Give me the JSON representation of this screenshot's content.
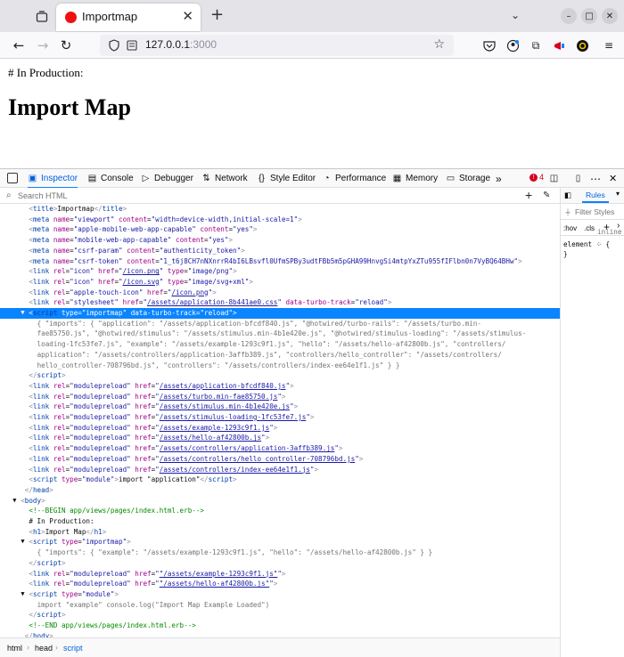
{
  "browser": {
    "tab_title": "Importmap",
    "url_host": "127.0.0.1",
    "url_port": ":3000"
  },
  "page": {
    "production_text": "# In Production:",
    "heading": "Import Map"
  },
  "devtools": {
    "tabs": [
      "Inspector",
      "Console",
      "Debugger",
      "Network",
      "Style Editor",
      "Performance",
      "Memory",
      "Storage"
    ],
    "error_count": "4",
    "search_placeholder": "Search HTML",
    "side_tab": "Rules",
    "filter_placeholder": "Filter Styles",
    "hov": ":hov",
    "cls": ".cls",
    "rule_inline": "inline",
    "rule_element": "element",
    "rule_open": "{",
    "rule_close": "}",
    "breadcrumb": [
      "html",
      "head",
      "script"
    ]
  },
  "colors": {
    "accent": "#0a84ff",
    "favicon": "#ee1111",
    "comment": "#058b00"
  },
  "markup_lines": [
    {
      "indent": 4,
      "html": "<span class='tag'>&lt;</span><span class='tn'>title</span><span class='tag'>&gt;</span>Importmap<span class='tag'>&lt;/</span><span class='tn'>title</span><span class='tag'>&gt;</span>"
    },
    {
      "indent": 4,
      "html": "<span class='tag'>&lt;</span><span class='tn'>meta</span> <span class='an'>name</span>=<span class='av'>\"viewport\"</span> <span class='an'>content</span>=<span class='av'>\"width=device-width,initial-scale=1\"</span><span class='tag'>&gt;</span>"
    },
    {
      "indent": 4,
      "html": "<span class='tag'>&lt;</span><span class='tn'>meta</span> <span class='an'>name</span>=<span class='av'>\"apple-mobile-web-app-capable\"</span> <span class='an'>content</span>=<span class='av'>\"yes\"</span><span class='tag'>&gt;</span>"
    },
    {
      "indent": 4,
      "html": "<span class='tag'>&lt;</span><span class='tn'>meta</span> <span class='an'>name</span>=<span class='av'>\"mobile-web-app-capable\"</span> <span class='an'>content</span>=<span class='av'>\"yes\"</span><span class='tag'>&gt;</span>"
    },
    {
      "indent": 4,
      "html": "<span class='tag'>&lt;</span><span class='tn'>meta</span> <span class='an'>name</span>=<span class='av'>\"csrf-param\"</span> <span class='an'>content</span>=<span class='av'>\"authenticity_token\"</span><span class='tag'>&gt;</span>"
    },
    {
      "indent": 4,
      "html": "<span class='tag'>&lt;</span><span class='tn'>meta</span> <span class='an'>name</span>=<span class='av'>\"csrf-token\"</span> <span class='an'>content</span>=<span class='av'>\"1_t6j8CH7nNXnrrR4bI6LBsvfl0UfmSPBy3udtFBb5m5pGHA99HnvgSi4mtpYxZTu955fIFlbn0n7VyBQ64BHw\"</span><span class='tag'>&gt;</span>"
    },
    {
      "indent": 4,
      "html": "<span class='tag'>&lt;</span><span class='tn'>link</span> <span class='an'>rel</span>=<span class='av'>\"icon\"</span> <span class='an'>href</span>=<span class='av'>\"<span class='lk'>/icon.png</span>\"</span> <span class='an'>type</span>=<span class='av'>\"image/png\"</span><span class='tag'>&gt;</span>"
    },
    {
      "indent": 4,
      "html": "<span class='tag'>&lt;</span><span class='tn'>link</span> <span class='an'>rel</span>=<span class='av'>\"icon\"</span> <span class='an'>href</span>=<span class='av'>\"<span class='lk'>/icon.svg</span>\"</span> <span class='an'>type</span>=<span class='av'>\"image/svg+xml\"</span><span class='tag'>&gt;</span>"
    },
    {
      "indent": 4,
      "html": "<span class='tag'>&lt;</span><span class='tn'>link</span> <span class='an'>rel</span>=<span class='av'>\"apple-touch-icon\"</span> <span class='an'>href</span>=<span class='av'>\"<span class='lk'>/icon.png</span>\"</span><span class='tag'>&gt;</span>"
    },
    {
      "indent": 4,
      "html": "<span class='tag'>&lt;</span><span class='tn'>link</span> <span class='an'>rel</span>=<span class='av'>\"stylesheet\"</span> <span class='an'>href</span>=<span class='av'>\"<span class='lk'>/assets/application-8b441ae0.css</span>\"</span> <span class='an'>data-turbo-track</span>=<span class='av'>\"reload\"</span><span class='tag'>&gt;</span>"
    },
    {
      "indent": 4,
      "sel": true,
      "twisty": "▼",
      "html": "<span class='tag'>&lt;</span><span class='tn'>script</span> <span class='an'>type</span>=<span class='av'>\"importmap\"</span> <span class='an'>data-turbo-track</span>=<span class='av'>\"reload\"</span><span class='tag'>&gt;</span>"
    },
    {
      "indent": 6,
      "html": "<span class='gr'>{ \"imports\": { \"application\": \"/assets/application-bfcdf840.js\", \"@hotwired/turbo-rails\": \"/assets/turbo.min-</span>"
    },
    {
      "indent": 6,
      "html": "<span class='gr'>fae85750.js\", \"@hotwired/stimulus\": \"/assets/stimulus.min-4b1e420e.js\", \"@hotwired/stimulus-loading\": \"/assets/stimulus-</span>"
    },
    {
      "indent": 6,
      "html": "<span class='gr'>loading-1fc53fe7.js\", \"example\": \"/assets/example-1293c9f1.js\", \"hello\": \"/assets/hello-af42800b.js\", \"controllers/</span>"
    },
    {
      "indent": 6,
      "html": "<span class='gr'>application\": \"/assets/controllers/application-3affb389.js\", \"controllers/hello_controller\": \"/assets/controllers/</span>"
    },
    {
      "indent": 6,
      "html": "<span class='gr'>hello_controller-708796bd.js\", \"controllers\": \"/assets/controllers/index-ee64e1f1.js\" } }</span>"
    },
    {
      "indent": 4,
      "html": "<span class='tag'>&lt;/</span><span class='tn'>script</span><span class='tag'>&gt;</span>"
    },
    {
      "indent": 4,
      "html": "<span class='tag'>&lt;</span><span class='tn'>link</span> <span class='an'>rel</span>=<span class='av'>\"modulepreload\"</span> <span class='an'>href</span>=<span class='av'>\"<span class='lk'>/assets/application-bfcdf840.js</span>\"</span><span class='tag'>&gt;</span>"
    },
    {
      "indent": 4,
      "html": "<span class='tag'>&lt;</span><span class='tn'>link</span> <span class='an'>rel</span>=<span class='av'>\"modulepreload\"</span> <span class='an'>href</span>=<span class='av'>\"<span class='lk'>/assets/turbo.min-fae85750.js</span>\"</span><span class='tag'>&gt;</span>"
    },
    {
      "indent": 4,
      "html": "<span class='tag'>&lt;</span><span class='tn'>link</span> <span class='an'>rel</span>=<span class='av'>\"modulepreload\"</span> <span class='an'>href</span>=<span class='av'>\"<span class='lk'>/assets/stimulus.min-4b1e420e.js</span>\"</span><span class='tag'>&gt;</span>"
    },
    {
      "indent": 4,
      "html": "<span class='tag'>&lt;</span><span class='tn'>link</span> <span class='an'>rel</span>=<span class='av'>\"modulepreload\"</span> <span class='an'>href</span>=<span class='av'>\"<span class='lk'>/assets/stimulus-loading-1fc53fe7.js</span>\"</span><span class='tag'>&gt;</span>"
    },
    {
      "indent": 4,
      "html": "<span class='tag'>&lt;</span><span class='tn'>link</span> <span class='an'>rel</span>=<span class='av'>\"modulepreload\"</span> <span class='an'>href</span>=<span class='av'>\"<span class='lk'>/assets/example-1293c9f1.js</span>\"</span><span class='tag'>&gt;</span>"
    },
    {
      "indent": 4,
      "html": "<span class='tag'>&lt;</span><span class='tn'>link</span> <span class='an'>rel</span>=<span class='av'>\"modulepreload\"</span> <span class='an'>href</span>=<span class='av'>\"<span class='lk'>/assets/hello-af42800b.js</span>\"</span><span class='tag'>&gt;</span>"
    },
    {
      "indent": 4,
      "html": "<span class='tag'>&lt;</span><span class='tn'>link</span> <span class='an'>rel</span>=<span class='av'>\"modulepreload\"</span> <span class='an'>href</span>=<span class='av'>\"<span class='lk'>/assets/controllers/application-3affb389.js</span>\"</span><span class='tag'>&gt;</span>"
    },
    {
      "indent": 4,
      "html": "<span class='tag'>&lt;</span><span class='tn'>link</span> <span class='an'>rel</span>=<span class='av'>\"modulepreload\"</span> <span class='an'>href</span>=<span class='av'>\"<span class='lk'>/assets/controllers/hello_controller-708796bd.js</span>\"</span><span class='tag'>&gt;</span>"
    },
    {
      "indent": 4,
      "html": "<span class='tag'>&lt;</span><span class='tn'>link</span> <span class='an'>rel</span>=<span class='av'>\"modulepreload\"</span> <span class='an'>href</span>=<span class='av'>\"<span class='lk'>/assets/controllers/index-ee64e1f1.js</span>\"</span><span class='tag'>&gt;</span>"
    },
    {
      "indent": 4,
      "html": "<span class='tag'>&lt;</span><span class='tn'>script</span> <span class='an'>type</span>=<span class='av'>\"module\"</span><span class='tag'>&gt;</span>import \"application\"<span class='tag'>&lt;/</span><span class='tn'>script</span><span class='tag'>&gt;</span>"
    },
    {
      "indent": 3,
      "html": "<span class='tag'>&lt;/</span><span class='tn'>head</span><span class='tag'>&gt;</span>"
    },
    {
      "indent": 2,
      "twisty": "▼",
      "html": "<span class='tag'>&lt;</span><span class='tn'>body</span><span class='tag'>&gt;</span>"
    },
    {
      "indent": 4,
      "html": "<span class='cm'>&lt;!--BEGIN app/views/pages/index.html.erb--&gt;</span>"
    },
    {
      "indent": 4,
      "html": "# In Production:"
    },
    {
      "indent": 4,
      "html": "<span class='tag'>&lt;</span><span class='tn'>h1</span><span class='tag'>&gt;</span>Import Map<span class='tag'>&lt;/</span><span class='tn'>h1</span><span class='tag'>&gt;</span>"
    },
    {
      "indent": 4,
      "twisty": "▼",
      "html": "<span class='tag'>&lt;</span><span class='tn'>script</span> <span class='an'>type</span>=<span class='av'>\"importmap\"</span><span class='tag'>&gt;</span>"
    },
    {
      "indent": 6,
      "html": "<span class='gr'>{ \"imports\": { \"example\": \"/assets/example-1293c9f1.js\", \"hello\": \"/assets/hello-af42800b.js\" } }</span>"
    },
    {
      "indent": 4,
      "html": "<span class='tag'>&lt;/</span><span class='tn'>script</span><span class='tag'>&gt;</span>"
    },
    {
      "indent": 4,
      "html": "<span class='tag'>&lt;</span><span class='tn'>link</span> <span class='an'>rel</span>=<span class='av'>\"modulepreload\"</span> <span class='an'>href</span>=<span class='av'>\"<span class='lk'>\"/assets/example-1293c9f1.js\"</span>\"</span><span class='tag'>&gt;</span>"
    },
    {
      "indent": 4,
      "html": "<span class='tag'>&lt;</span><span class='tn'>link</span> <span class='an'>rel</span>=<span class='av'>\"modulepreload\"</span> <span class='an'>href</span>=<span class='av'>\"<span class='lk'>\"/assets/hello-af42800b.js\"</span>\"</span><span class='tag'>&gt;</span>"
    },
    {
      "indent": 4,
      "twisty": "▼",
      "html": "<span class='tag'>&lt;</span><span class='tn'>script</span> <span class='an'>type</span>=<span class='av'>\"module\"</span><span class='tag'>&gt;</span>"
    },
    {
      "indent": 6,
      "html": "<span class='gr'>import \"example\" console.log(\"Import Map Example Loaded\")</span>"
    },
    {
      "indent": 4,
      "html": "<span class='tag'>&lt;/</span><span class='tn'>script</span><span class='tag'>&gt;</span>"
    },
    {
      "indent": 4,
      "html": "<span class='cm'>&lt;!--END app/views/pages/index.html.erb--&gt;</span>"
    },
    {
      "indent": 3,
      "html": "<span class='tag'>&lt;/</span><span class='tn'>body</span><span class='tag'>&gt;</span>"
    }
  ]
}
